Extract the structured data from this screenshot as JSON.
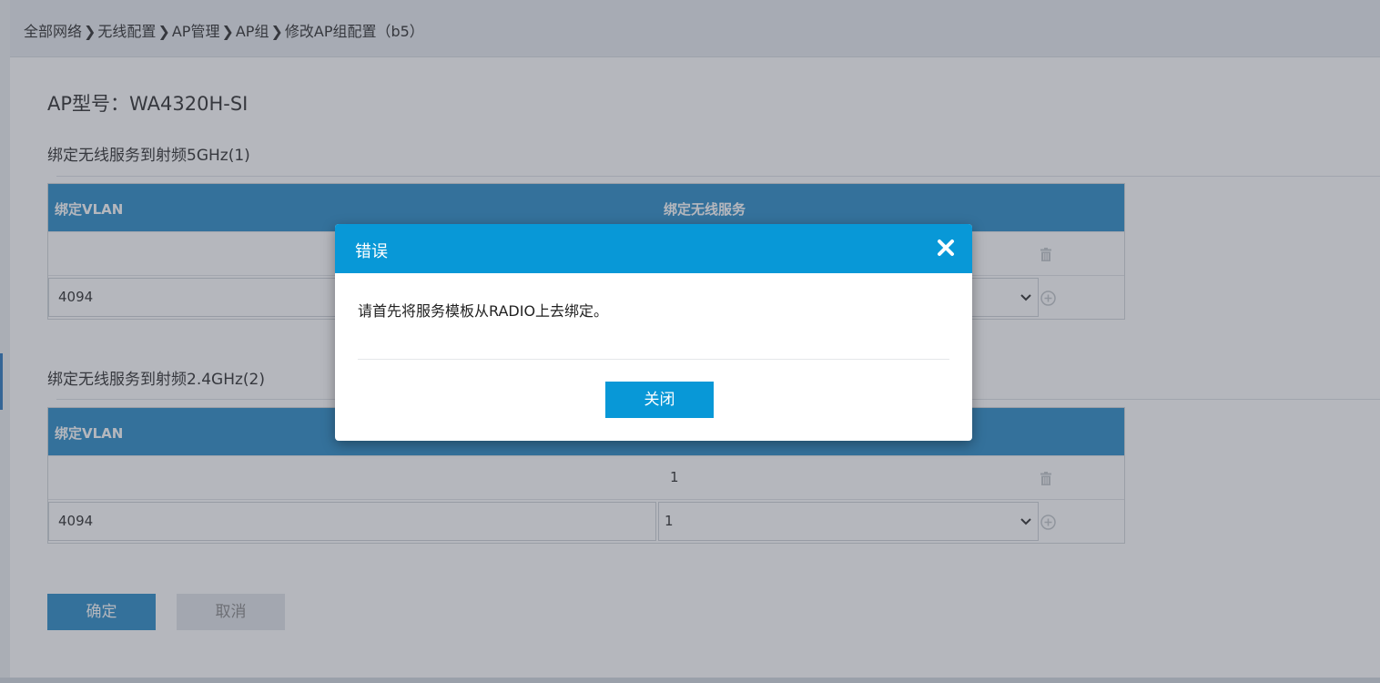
{
  "breadcrumb": {
    "items": [
      "全部网络",
      "无线配置",
      "AP管理",
      "AP组",
      "修改AP组配置（b5）"
    ],
    "separator": "❯"
  },
  "model": {
    "text": "AP型号：WA4320H-SI"
  },
  "sections": [
    {
      "title": "绑定无线服务到射频5GHz(1)",
      "col_vlan": "绑定VLAN",
      "col_service": "绑定无线服务",
      "bound_row": {
        "vlan": "",
        "service": ""
      },
      "input_row": {
        "vlan_value": "4094",
        "service_value": ""
      }
    },
    {
      "title": "绑定无线服务到射频2.4GHz(2)",
      "col_vlan": "绑定VLAN",
      "col_service": "",
      "bound_row": {
        "vlan": "",
        "service": "1"
      },
      "input_row": {
        "vlan_value": "4094",
        "service_value": "1"
      }
    }
  ],
  "buttons": {
    "confirm": "确定",
    "cancel": "取消"
  },
  "dialog": {
    "title": "错误",
    "message": "请首先将服务模板从RADIO上去绑定。",
    "close_button": "关闭"
  },
  "colors": {
    "accent": "#0898d7",
    "table_header": "#2f8fc9",
    "overlay": "rgba(60,66,82,0.38)"
  },
  "icons": {
    "breadcrumb_separator": "chevron-right-icon",
    "delete": "trash-icon",
    "add": "plus-circle-icon",
    "dropdown": "chevron-down-icon",
    "close": "close-icon"
  }
}
